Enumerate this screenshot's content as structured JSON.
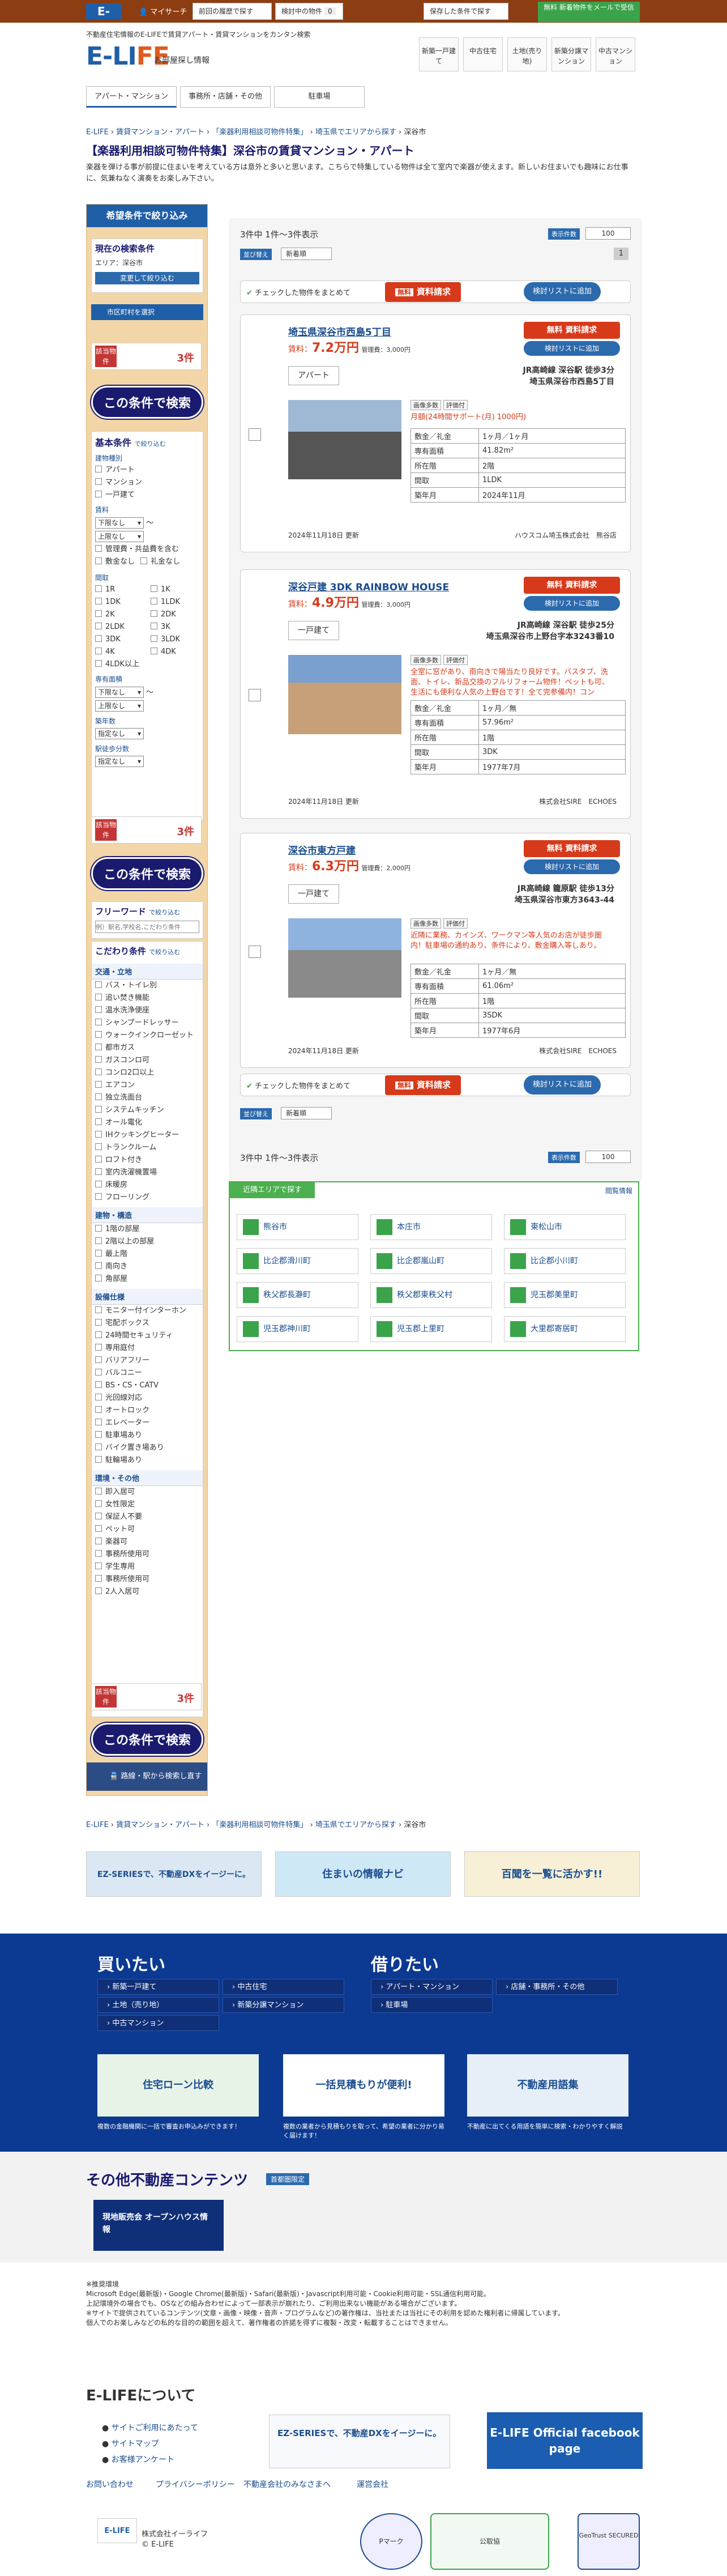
{
  "topbar": {
    "logo": "E-LIFE",
    "mysearch": "マイサーチ",
    "recent": "前回の履歴で探す",
    "consider": "検討中の物件",
    "consider_count": "0",
    "saved": "保存した条件で探す",
    "promo": "無料 新着物件をメールで受信"
  },
  "header": {
    "tagline": "不動産住宅情報のE-LIFEで賃貸アパート・賃貸マンションをカンタン検索",
    "logo_main": "E-LI",
    "logo_accent": "FE",
    "logo_sub": "お部屋探し情報",
    "nav": [
      "新築一戸建て",
      "中古住宅",
      "土地(売り地)",
      "新築分譲マンション",
      "中古マンション"
    ]
  },
  "cat_tabs": [
    "アパート・マンション",
    "事務所・店舗・その他",
    "駐車場"
  ],
  "breadcrumb": [
    "E-LIFE",
    "賃貸マンション・アパート",
    "「楽器利用相談可物件特集」",
    "埼玉県でエリアから探す",
    "深谷市"
  ],
  "page": {
    "title": "【楽器利用相談可物件特集】深谷市の賃貸マンション・アパート",
    "intro": "楽器を弾ける事が前提に住まいを考えている方は意外と多いと思います。こちらで特集している物件は全て室内で楽器が使えます。新しいお住まいでも趣味にお仕事に、気兼ねなく演奏をお楽しみ下さい。"
  },
  "sidebar": {
    "head": "希望条件で絞り込み",
    "current_title": "現在の検索条件",
    "current_area": "エリア：深谷市",
    "change_btn": "変更して絞り込む",
    "city_btn": "市区町村を選択",
    "hit_label": "該当物件",
    "hit_count": "3件",
    "search_btn": "この条件で検索",
    "basic_title": "基本条件",
    "narrow": "で絞り込む",
    "ptype_title": "建物種別",
    "ptypes": [
      "アパート",
      "マンション",
      "一戸建て"
    ],
    "rent_title": "賃料",
    "rent_lower": "下限なし",
    "rent_upper": "上限なし",
    "rent_opts": [
      "管理費・共益費を含む",
      "敷金なし",
      "礼金なし"
    ],
    "layout_title": "間取",
    "layouts": [
      "1R",
      "1K",
      "1DK",
      "1LDK",
      "2K",
      "2DK",
      "2LDK",
      "3K",
      "3DK",
      "3LDK",
      "4K",
      "4DK",
      "4LDK以上"
    ],
    "area_title": "専有面積",
    "area_lower": "下限なし",
    "area_upper": "上限なし",
    "age_title": "築年数",
    "age_val": "指定なし",
    "walk_title": "駅徒歩分数",
    "walk_val": "指定なし",
    "free_title": "フリーワード",
    "free_placeholder": "例）駅名,学校名,こだわり条件",
    "kodawari_title": "こだわり条件",
    "f1_title": "交通・立地",
    "f1": [
      "バス・トイレ別",
      "追い焚き機能",
      "温水洗浄便座",
      "シャンプードレッサー",
      "ウォークインクローゼット",
      "都市ガス",
      "ガスコンロ可",
      "コンロ2口以上",
      "エアコン",
      "独立洗面台",
      "システムキッチン",
      "オール電化",
      "IHクッキングヒーター",
      "トランクルーム",
      "ロフト付き",
      "室内洗濯機置場",
      "床暖房",
      "フローリング"
    ],
    "f2_title": "建物・構造",
    "f2": [
      "1階の部屋",
      "2階以上の部屋",
      "最上階",
      "南向き",
      "角部屋"
    ],
    "f3_title": "設備仕様",
    "f3": [
      "モニター付インターホン",
      "宅配ボックス",
      "24時間セキュリティ",
      "専用庭付",
      "バリアフリー",
      "バルコニー",
      "BS・CS・CATV",
      "光回線対応",
      "オートロック",
      "エレベーター",
      "駐車場あり",
      "バイク置き場あり",
      "駐輪場あり"
    ],
    "f4_title": "環境・その他",
    "f4": [
      "即入居可",
      "女性限定",
      "保証人不要",
      "ペット可",
      "楽器可",
      "事務所使用可",
      "学生専用",
      "事務所使用可",
      "2人入居可"
    ],
    "station_btn": "路線・駅から検索し直す"
  },
  "results": {
    "count_text": "3件中 1件～3件表示",
    "per_page_label": "表示件数",
    "per_page": "100",
    "sort_label": "並び替え",
    "sort_val": "新着順",
    "page": "1",
    "check_all": "チェックした物件をまとめて",
    "free_req": "資料請求",
    "free": "無料",
    "add_list": "検討リストに追加",
    "add_list_small": "検討リストに追加",
    "listings": [
      {
        "title": "埼玉県深谷市西島5丁目",
        "rent_label": "賃料：",
        "rent": "7.2万円",
        "fee": "管理費：3,000円",
        "type": "アパート",
        "access1": "JR高崎線 深谷駅 徒歩3分",
        "access2": "埼玉県深谷市西島5丁目",
        "tags": [
          "画像多数",
          "評価付"
        ],
        "pr": "月額(24時間サポート(月) 1000円)",
        "specs": [
          [
            "敷金／礼金",
            "1ヶ月／1ヶ月"
          ],
          [
            "専有面積",
            "41.82m²"
          ],
          [
            "所在階",
            "2階"
          ],
          [
            "間取",
            "1LDK"
          ],
          [
            "築年月",
            "2024年11月"
          ]
        ],
        "updated": "2024年11月18日 更新",
        "company": "ハウスコム埼玉株式会社　熊谷店"
      },
      {
        "title": "深谷戸建 3DK RAINBOW HOUSE",
        "rent_label": "賃料：",
        "rent": "4.9万円",
        "fee": "管理費：3,000円",
        "type": "一戸建て",
        "access1": "JR高崎線 深谷駅 徒歩25分",
        "access2": "埼玉県深谷市上野台字本3243番10",
        "tags": [
          "画像多数",
          "評価付"
        ],
        "pr": "全室に窓があり、南向きで陽当たり良好です。バスタブ、洗面、トイレ、新品交換のフルリフォーム物件！ペットも可、生活にも便利な人気の上野台です！全て完参備内！コン",
        "specs": [
          [
            "敷金／礼金",
            "1ヶ月／無"
          ],
          [
            "専有面積",
            "57.96m²"
          ],
          [
            "所在階",
            "1階"
          ],
          [
            "間取",
            "3DK"
          ],
          [
            "築年月",
            "1977年7月"
          ]
        ],
        "updated": "2024年11月18日 更新",
        "company": "株式会社SIRE　ECHOES"
      },
      {
        "title": "深谷市東方戸建",
        "rent_label": "賃料：",
        "rent": "6.3万円",
        "fee": "管理費：2,000円",
        "type": "一戸建て",
        "access1": "JR高崎線 籠原駅 徒歩13分",
        "access2": "埼玉県深谷市東方3643-44",
        "tags": [
          "画像多数",
          "評価付"
        ],
        "pr": "近隣に業務、カインズ、ワークマン等人気のお店が徒歩圏内！駐車場の通約あり、条件により、敷金購入等しあり。",
        "specs": [
          [
            "敷金／礼金",
            "1ヶ月／無"
          ],
          [
            "専有面積",
            "61.06m²"
          ],
          [
            "所在階",
            "1階"
          ],
          [
            "間取",
            "3SDK"
          ],
          [
            "築年月",
            "1977年6月"
          ]
        ],
        "updated": "2024年11月18日 更新",
        "company": "株式会社SIRE　ECHOES"
      }
    ]
  },
  "nearby": {
    "head": "近隣エリアで探す",
    "link": "閲覧情報",
    "areas": [
      "熊谷市",
      "本庄市",
      "東松山市",
      "比企郡滑川町",
      "比企郡嵐山町",
      "比企郡小川町",
      "秩父郡長瀞町",
      "秩父郡東秩父村",
      "児玉郡美里町",
      "児玉郡神川町",
      "児玉郡上里町",
      "大里郡寄居町"
    ]
  },
  "footer": {
    "breadcrumb": [
      "E-LIFE",
      "賃貸マンション・アパート",
      "「楽器利用相談可物件特集」",
      "埼玉県でエリアから探す",
      "深谷市"
    ],
    "banners": [
      "EZ-SERIESで、不動産DXをイージーに。",
      "住まいの情報ナビ",
      "百聞を一覧に活かす!!"
    ],
    "buy_title": "買いたい",
    "buy": [
      "新築一戸建て",
      "中古住宅",
      "土地（売り地）",
      "新築分譲マンション",
      "中古マンション"
    ],
    "rent_title": "借りたい",
    "rent": [
      "アパート・マンション",
      "店舗・事務所・その他",
      "駐車場"
    ],
    "wide_banners": [
      "住宅ローン比較",
      "一括見積もりが便利!",
      "不動産用語集"
    ],
    "wide_texts": [
      "複数の金融機関に一括で審査お申込みができます！",
      "複数の業者から見積もりを取って、希望の業者に分かり易く届けます！",
      "不動産に出てくる用語を簡単に検索・わかりやすく解説"
    ],
    "other_title": "その他不動産コンテンツ",
    "other_tag": "首都圏限定",
    "other_banner": "現地販売会 オープンハウス情報",
    "notes": "※推奨環境\nMicrosoft Edge(最新版)・Google Chrome(最新版)・Safari(最新版)・Javascript利用可能・Cookie利用可能・SSL通信利用可能。\n上記環境外の場合でも、OSなどの組み合わせによって一部表示が崩れたり、ご利用出来ない機能がある場合がございます。\n※サイトで提供されているコンテンツ(文章・画像・映像・音声・プログラムなど)の著作権は、当社または当社にその利用を認めた権利者に帰属しています。\n個人でのお楽しみなどの私的な目的の範囲を超えて、著作権者の許諾を得ずに複製・改変・転載することはできません。",
    "about_title": "E-LIFEについて",
    "about_links": [
      "サイトご利用にあたって",
      "サイトマップ",
      "お客様アンケート"
    ],
    "ez": "EZ-SERIESで、不動産DXをイージーに。",
    "fb": "E-LIFE Official facebook page",
    "bottom_links": [
      "お問い合わせ",
      "プライバシーポリシー",
      "不動産会社のみなさまへ",
      "運営会社"
    ],
    "company": "株式会社イーライフ",
    "copyright": "© E-LIFE",
    "badges": [
      "Pマーク",
      "公取協",
      "GeoTrust SECURED"
    ]
  }
}
